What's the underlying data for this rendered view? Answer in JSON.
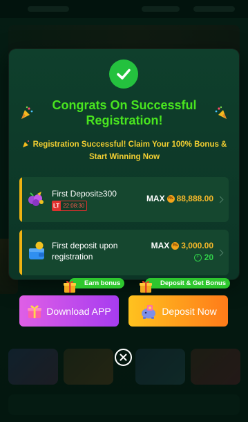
{
  "modal": {
    "headline": "Congrats On Successful Registration!",
    "subline": "Registration Successful! Claim Your 100% Bonus & Start Winning Now",
    "offers": [
      {
        "title": "First Deposit≥300",
        "badge_lt": "LT",
        "timer": "22:08:30",
        "max_label": "MAX",
        "currency_symbol": "₨",
        "max_value": "88,888.00"
      },
      {
        "title": "First deposit upon registration",
        "max_label": "MAX",
        "currency_symbol": "₨",
        "max_value": "3,000.00",
        "bonus_value": "20"
      }
    ],
    "tags": {
      "download": "Earn bonus",
      "deposit": "Deposit & Get Bonus"
    },
    "buttons": {
      "download": "Download APP",
      "deposit": "Deposit Now"
    }
  },
  "colors": {
    "headline": "#49e51f",
    "subline": "#f3cf32",
    "accent_gold": "#f5b82a",
    "success_green": "#24c13e",
    "download_gradient": [
      "#df5fe6",
      "#a73cf0"
    ],
    "deposit_gradient": [
      "#ffc21f",
      "#ff7b1a"
    ]
  },
  "icons": {
    "check": "check-circle-icon",
    "party": "party-popper-icon",
    "fruit": "fruit-slot-icon",
    "wallet": "wallet-icon",
    "gift": "gift-icon",
    "deposit": "piggy-deposit-icon",
    "close": "close-icon"
  }
}
